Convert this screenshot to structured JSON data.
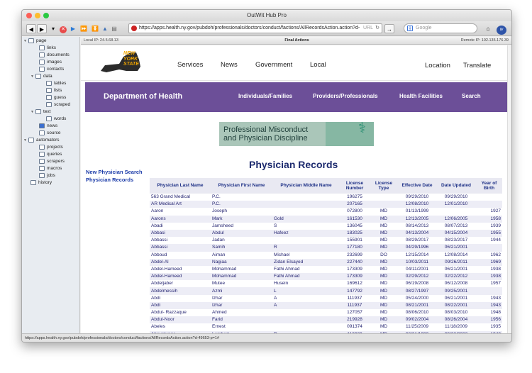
{
  "window": {
    "title": "OutWit Hub Pro"
  },
  "toolbar": {
    "url": "https://apps.health.ny.gov/pubdoh/professionals/doctors/conduct/factions/AllRecordsAction.action?d-",
    "url_hint": "URL",
    "search_placeholder": "Google"
  },
  "sidebar": {
    "items": [
      {
        "label": "page"
      },
      {
        "label": "links"
      },
      {
        "label": "documents"
      },
      {
        "label": "images"
      },
      {
        "label": "contacts"
      },
      {
        "label": "data"
      },
      {
        "label": "tables"
      },
      {
        "label": "lists"
      },
      {
        "label": "guess"
      },
      {
        "label": "scraped"
      },
      {
        "label": "text"
      },
      {
        "label": "words"
      },
      {
        "label": "news"
      },
      {
        "label": "source"
      },
      {
        "label": "automators"
      },
      {
        "label": "projects"
      },
      {
        "label": "queries"
      },
      {
        "label": "scrapers"
      },
      {
        "label": "macros"
      },
      {
        "label": "jobs"
      },
      {
        "label": "history"
      }
    ]
  },
  "infobar": {
    "local_ip": "Local IP:   24.5.68.13",
    "center": "Final Actions",
    "remote_ip": "Remote IP:   192.135.176.39"
  },
  "site": {
    "logo_lines": [
      "NEW",
      "YORK",
      "STATE"
    ],
    "top_nav": [
      "Services",
      "News",
      "Government",
      "Local"
    ],
    "top_right": [
      "Location",
      "Translate"
    ],
    "doh_title": "Department of Health",
    "doh_nav": [
      "Individuals/Families",
      "Providers/Professionals",
      "Health Facilities",
      "Search"
    ],
    "banner_line1": "Professional Misconduct",
    "banner_line2": "and Physician Discipline",
    "left_links": [
      "New Physician Search",
      "Physician Records"
    ],
    "records_title": "Physician Records"
  },
  "table": {
    "headers": [
      "Physician Last Name",
      "Physician First Name",
      "Physician Middle Name",
      "License Number",
      "License Type",
      "Effective Date",
      "Date Updated",
      "Year of Birth"
    ],
    "rows": [
      [
        "563 Grand Medical",
        "P.C.",
        "",
        "196275",
        "",
        "09/29/2010",
        "09/29/2010",
        ""
      ],
      [
        "AR Medical Art",
        "P.C.",
        "",
        "207165",
        "",
        "12/08/2010",
        "12/01/2010",
        ""
      ],
      [
        "Aaron",
        "Joseph",
        "",
        "072800",
        "MD",
        "01/13/1999",
        "",
        "1927"
      ],
      [
        "Aarons",
        "Mark",
        "Gold",
        "161530",
        "MD",
        "12/13/2005",
        "12/06/2005",
        "1958"
      ],
      [
        "Abadi",
        "Jamsheed",
        "S",
        "136045",
        "MD",
        "08/14/2013",
        "08/07/2013",
        "1939"
      ],
      [
        "Abbasi",
        "Abdul",
        "Hafeez",
        "183025",
        "MD",
        "04/13/2004",
        "04/15/2004",
        "1955"
      ],
      [
        "Abbassi",
        "Jadan",
        "",
        "155901",
        "MD",
        "08/29/2017",
        "08/23/2017",
        "1944"
      ],
      [
        "Abbassi",
        "Samih",
        "R",
        "177180",
        "MD",
        "04/29/1996",
        "06/21/2001",
        ""
      ],
      [
        "Abboud",
        "Aiman",
        "Michael",
        "232699",
        "DO",
        "12/15/2014",
        "12/08/2014",
        "1962"
      ],
      [
        "Abdel-Al",
        "Nagiaa",
        "Zidan Elsayed",
        "227440",
        "MD",
        "10/03/2011",
        "09/26/2011",
        "1969"
      ],
      [
        "Abdel-Hameed",
        "Mohammad",
        "Fathi Ahmad",
        "173309",
        "MD",
        "04/11/2001",
        "06/21/2001",
        "1938"
      ],
      [
        "Abdel-Hameed",
        "Mohammad",
        "Fathi Ahmad",
        "173309",
        "MD",
        "02/29/2012",
        "02/22/2012",
        "1938"
      ],
      [
        "Abdeljaber",
        "Mutee",
        "Husein",
        "169612",
        "MD",
        "06/19/2008",
        "06/12/2008",
        "1957"
      ],
      [
        "Abdelmessih",
        "Azmi",
        "L",
        "147792",
        "MD",
        "08/27/1997",
        "09/25/2001",
        ""
      ],
      [
        "Abdi",
        "Izhar",
        "A",
        "111937",
        "MD",
        "05/24/2000",
        "06/21/2001",
        "1943"
      ],
      [
        "Abdi",
        "Izhar",
        "A",
        "111937",
        "MD",
        "08/21/2001",
        "08/22/2001",
        "1943"
      ],
      [
        "Abdul- Razzaque",
        "Ahmed",
        "",
        "127057",
        "MD",
        "08/06/2010",
        "08/03/2010",
        "1948"
      ],
      [
        "Abdul-Noor",
        "Farid",
        "",
        "219928",
        "MD",
        "09/02/2004",
        "08/26/2004",
        "1956"
      ],
      [
        "Abeles",
        "Ernest",
        "",
        "091374",
        "MD",
        "11/25/2009",
        "11/18/2009",
        "1935"
      ],
      [
        "Abeyatunge",
        "Lambert",
        "R",
        "113939",
        "MD",
        "02/21/1990",
        "09/23/2002",
        "1940"
      ]
    ]
  },
  "statusbar": {
    "text": "https://apps.health.ny.gov/pubdoh/professionals/doctors/conduct/factions/AllRecordsAction.action?d-49653-p=1#"
  }
}
